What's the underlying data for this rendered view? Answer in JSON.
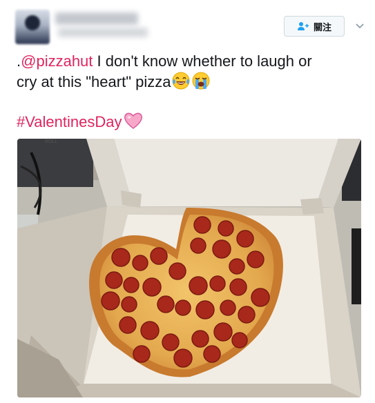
{
  "header": {
    "follow_label": "關注"
  },
  "tweet": {
    "prefix": ".",
    "mention": "@pizzahut",
    "text_line1": " I don't know whether to laugh or",
    "text_line2": "cry at this \"heart\" pizza",
    "hashtag": "#ValentinesDay"
  },
  "photo": {
    "box_label": "ROLL"
  },
  "colors": {
    "accent": "#e0245e",
    "button_border": "#cfd9de"
  },
  "icons": {
    "follow": "add-user-icon",
    "caret": "chevron-down-icon",
    "emoji1": "laughing-tears-emoji",
    "emoji2": "loudly-crying-emoji",
    "heart": "pink-heart-emoji"
  }
}
